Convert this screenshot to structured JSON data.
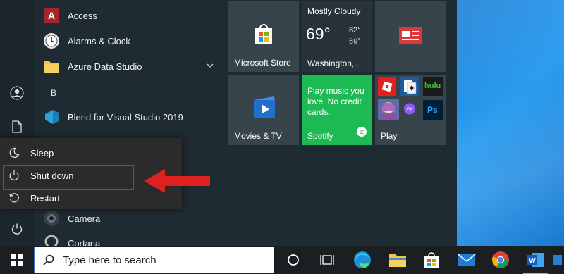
{
  "apps": [
    {
      "label": "Access"
    },
    {
      "label": "Alarms & Clock"
    },
    {
      "label": "Azure Data Studio"
    },
    {
      "label": "Blend for Visual Studio 2019"
    },
    {
      "label": "Camera"
    },
    {
      "label": "Cortana"
    }
  ],
  "section_letter": "B",
  "power_menu": {
    "items": [
      {
        "label": "Sleep"
      },
      {
        "label": "Shut down"
      },
      {
        "label": "Restart"
      }
    ]
  },
  "tiles": {
    "store": {
      "label": "Microsoft Store"
    },
    "weather": {
      "condition": "Mostly Cloudy",
      "temp": "69°",
      "high": "82°",
      "low": "69°",
      "location": "Washington,..."
    },
    "movies": {
      "label": "Movies & TV"
    },
    "spotify": {
      "text": "Play music you love. No credit cards.",
      "label": "Spotify"
    },
    "play": {
      "label": "Play",
      "hulu": "hulu",
      "ps": "Ps"
    }
  },
  "taskbar": {
    "search_placeholder": "Type here to search"
  },
  "colors": {
    "spotify_green": "#1db954",
    "arrow_red": "#e02020",
    "highlight_box": "#e02020",
    "start_bg": "#1f2b32",
    "desktop_blue": "#1f8ae3"
  }
}
